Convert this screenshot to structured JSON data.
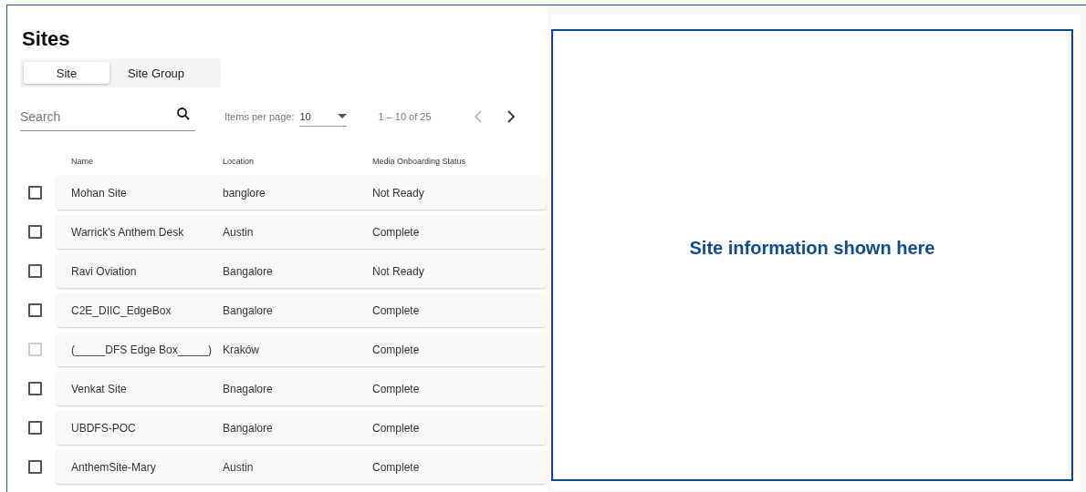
{
  "title": "Sites",
  "tabs": [
    {
      "label": "Site",
      "selected": true
    },
    {
      "label": "Site Group",
      "selected": false
    }
  ],
  "search": {
    "placeholder": "Search"
  },
  "paginator": {
    "items_per_page_label": "Items per page:",
    "items_per_page": "10",
    "range": "1 – 10 of 25",
    "previous_disabled": true,
    "next_disabled": false
  },
  "table": {
    "columns": [
      "Name",
      "Location",
      "Media Onboarding Status"
    ],
    "rows": [
      {
        "name": "Mohan Site",
        "location": "banglore",
        "status": "Not Ready",
        "checked": false,
        "disabled": false
      },
      {
        "name": "Warrick's Anthem Desk",
        "location": "Austin",
        "status": "Complete",
        "checked": false,
        "disabled": false
      },
      {
        "name": "Ravi Oviation",
        "location": "Bangalore",
        "status": "Not Ready",
        "checked": false,
        "disabled": false
      },
      {
        "name": "C2E_DIIC_EdgeBox",
        "location": "Bangalore",
        "status": "Complete",
        "checked": false,
        "disabled": false
      },
      {
        "name": "(_____DFS Edge Box_____)",
        "location": "Kraków",
        "status": "Complete",
        "checked": false,
        "disabled": true
      },
      {
        "name": "Venkat Site",
        "location": "Bnagalore",
        "status": "Complete",
        "checked": false,
        "disabled": false
      },
      {
        "name": "UBDFS-POC",
        "location": "Bangalore",
        "status": "Complete",
        "checked": false,
        "disabled": false
      },
      {
        "name": "AnthemSite-Mary",
        "location": "Austin",
        "status": "Complete",
        "checked": false,
        "disabled": false
      }
    ]
  },
  "detail_panel": {
    "message": "Site information shown here"
  }
}
